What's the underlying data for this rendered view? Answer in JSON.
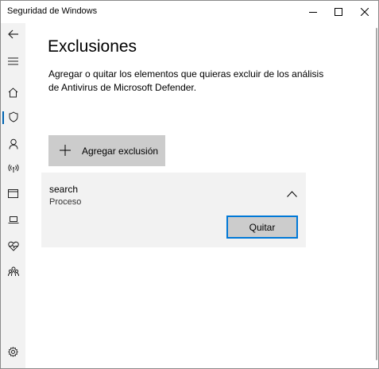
{
  "window": {
    "title": "Seguridad de Windows",
    "controls": [
      "minimize-icon",
      "maximize-icon",
      "close-icon"
    ]
  },
  "sidebar": {
    "items": [
      {
        "icon": "back-arrow-icon",
        "name": "back-button"
      },
      {
        "icon": "hamburger-menu-icon",
        "name": "menu-button"
      },
      {
        "icon": "home-icon",
        "name": "sidebar-item-home"
      },
      {
        "icon": "shield-icon",
        "name": "sidebar-item-virus-protection",
        "active": true
      },
      {
        "icon": "person-icon",
        "name": "sidebar-item-account-protection"
      },
      {
        "icon": "wifi-antenna-icon",
        "name": "sidebar-item-firewall-network"
      },
      {
        "icon": "browser-window-icon",
        "name": "sidebar-item-app-browser-control"
      },
      {
        "icon": "laptop-icon",
        "name": "sidebar-item-device-security"
      },
      {
        "icon": "heart-pulse-icon",
        "name": "sidebar-item-device-performance"
      },
      {
        "icon": "family-icon",
        "name": "sidebar-item-family-options"
      },
      {
        "icon": "gear-icon",
        "name": "sidebar-item-settings"
      }
    ],
    "accent": "#0063b1"
  },
  "main": {
    "title": "Exclusiones",
    "description": "Agregar o quitar los elementos que quieras excluir de los análisis de Antivirus de Microsoft Defender.",
    "add_button": {
      "label": "Agregar exclusión",
      "icon": "plus-icon"
    },
    "exclusions": [
      {
        "name": "search",
        "type": "Proceso",
        "expanded": true,
        "remove_label": "Quitar"
      }
    ]
  },
  "colors": {
    "focus_border": "#0078d7",
    "button_bg": "#cccccc",
    "card_bg": "#f2f2f2",
    "sidebar_bg": "#f2f2f2"
  }
}
